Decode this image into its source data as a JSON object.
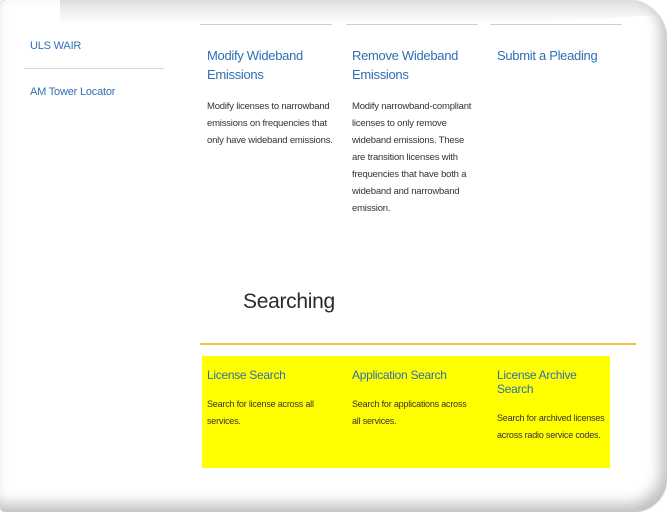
{
  "sidebar": {
    "items": [
      {
        "label": "ULS WAIR"
      },
      {
        "label": "AM Tower Locator"
      }
    ]
  },
  "cards": [
    {
      "title": "Modify Wideband Emissions",
      "description": "Modify licenses to narrowband emissions on frequencies that only have wideband emissions."
    },
    {
      "title": "Remove Wideband Emissions",
      "description": "Modify narrowband-compliant licenses to only remove wideband emissions. These are transition licenses with frequencies that have both a wideband and narrowband emission."
    },
    {
      "title": "Submit a Pleading",
      "description": ""
    }
  ],
  "searching": {
    "title": "Searching",
    "items": [
      {
        "title": "License Search",
        "description": "Search for license across all services."
      },
      {
        "title": "Application Search",
        "description": "Search for applications across all services."
      },
      {
        "title": "License Archive Search",
        "description": "Search for archived licenses across radio service codes."
      }
    ]
  },
  "colors": {
    "link": "#2f6fb3",
    "accent_rule": "#f2c14a",
    "highlight": "#ffff00",
    "text": "#333333"
  }
}
